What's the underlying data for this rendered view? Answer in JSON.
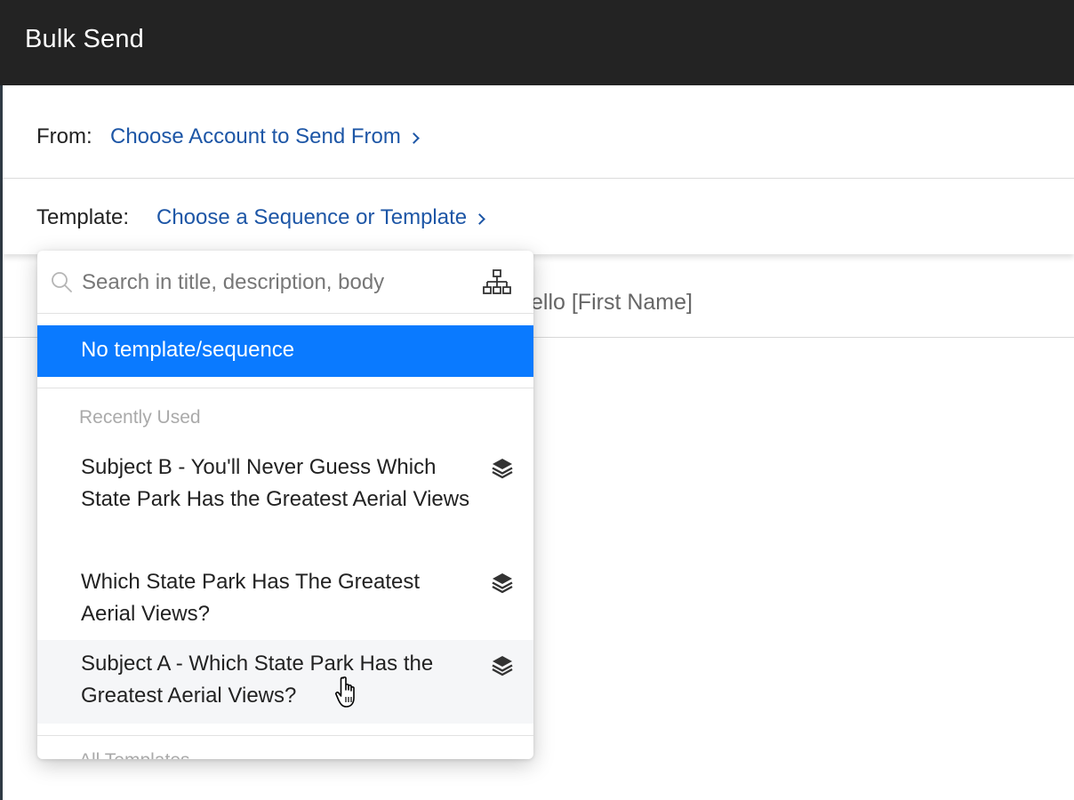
{
  "window": {
    "title": "Bulk Send"
  },
  "from": {
    "label": "From:",
    "link": "Choose Account to Send From"
  },
  "template": {
    "label": "Template:",
    "link": "Choose a Sequence or Template"
  },
  "subject": {
    "partial_text": "ello [First Name]"
  },
  "dropdown": {
    "search_placeholder": "Search in title, description, body",
    "selected_option": "No template/sequence",
    "recent_section_label": "Recently Used",
    "all_section_label": "All Templates",
    "items": [
      {
        "text": "Subject B - You'll Never Guess Which State Park Has the Greatest Aerial Views",
        "icon": "layers-icon"
      },
      {
        "text": "Which State Park Has The Greatest Aerial Views?",
        "icon": "layers-icon"
      },
      {
        "text": "Subject A - Which State Park Has the Greatest Aerial Views?",
        "icon": "layers-icon",
        "hovered": true
      }
    ]
  },
  "colors": {
    "title_bar": "#232323",
    "link": "#1d56a6",
    "selected_bg": "#0a7aff",
    "hover_bg": "#f5f6f8"
  }
}
